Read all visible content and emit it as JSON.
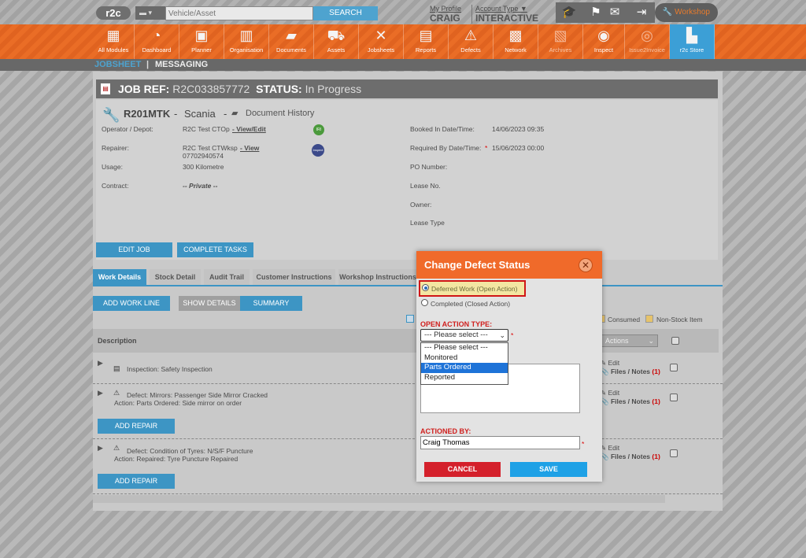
{
  "topbar": {
    "logo": "r2c",
    "search_placeholder": "Vehicle/Asset",
    "search_button": "SEARCH",
    "my_profile_label": "My Profile",
    "user_name": "CRAIG",
    "account_type_label": "Account Type",
    "account_type": "INTERACTIVE",
    "workshop_label": "Workshop"
  },
  "nav": {
    "items": [
      {
        "label": "All Modules",
        "icon": "grid-icon"
      },
      {
        "label": "Dashboard",
        "icon": "gauge-icon"
      },
      {
        "label": "Planner",
        "icon": "calendar-icon"
      },
      {
        "label": "Organisation",
        "icon": "building-icon"
      },
      {
        "label": "Documents",
        "icon": "folder-icon"
      },
      {
        "label": "Assets",
        "icon": "truck-icon"
      },
      {
        "label": "Jobsheets",
        "icon": "tools-icon"
      },
      {
        "label": "Reports",
        "icon": "clipboard-icon"
      },
      {
        "label": "Defects",
        "icon": "warning-icon"
      },
      {
        "label": "Network",
        "icon": "contacts-icon"
      },
      {
        "label": "Archives",
        "icon": "archive-icon"
      },
      {
        "label": "Inspect",
        "icon": "inspect-icon"
      },
      {
        "label": "Issue2Invoice",
        "icon": "invoice-icon"
      },
      {
        "label": "r2c Store",
        "icon": "briefcase-icon"
      }
    ]
  },
  "subnav": {
    "jobsheet": "JOBSHEET",
    "messaging": "MESSAGING"
  },
  "job": {
    "ref_label": "JOB REF:",
    "ref": "R2C033857772",
    "status_label": "STATUS:",
    "status": "In Progress",
    "vehicle": "R201MTK",
    "make": "Scania",
    "doc_history": "Document History",
    "operator_label": "Operator / Depot:",
    "operator": "R2C Test CTOp",
    "operator_link": "- View/Edit",
    "repairer_label": "Repairer:",
    "repairer": "R2C Test CTWksp",
    "repairer_link": "- View",
    "repairer_phone": "07702940574",
    "usage_label": "Usage:",
    "usage": "300 Kilometre",
    "contract_label": "Contract:",
    "contract": "-- Private --",
    "badge1": "IRI",
    "badge2": "Inspect",
    "booked_label": "Booked In Date/Time:",
    "booked": "14/06/2023 09:35",
    "required_label": "Required By Date/Time:",
    "required": "15/06/2023 00:00",
    "po_label": "PO Number:",
    "lease_no_label": "Lease No.",
    "owner_label": "Owner:",
    "lease_type_label": "Lease Type",
    "edit_job": "EDIT JOB",
    "complete_tasks": "COMPLETE TASKS"
  },
  "tabs": [
    "Work Details",
    "Stock Detail",
    "Audit Trail",
    "Customer Instructions",
    "Workshop Instructions"
  ],
  "work": {
    "add_work_line": "ADD WORK LINE",
    "show_details": "SHOW DETAILS",
    "summary": "SUMMARY",
    "consumed": "Consumed",
    "non_stock": "Non-Stock Item",
    "description_header": "Description",
    "actions": "Actions",
    "edit": "Edit",
    "files_notes": "Files / Notes",
    "count": "(1)",
    "add_repair": "ADD REPAIR",
    "lines": [
      {
        "line1": "Inspection: Safety Inspection",
        "line2": ""
      },
      {
        "line1": "Defect: Mirrors: Passenger Side Mirror Cracked",
        "line2": "Action: Parts Ordered: Side mirror on order"
      },
      {
        "line1": "Defect: Condition of Tyres: N/S/F Puncture",
        "line2": "Action: Repaired: Tyre Puncture Repaired"
      }
    ]
  },
  "dialog": {
    "title": "Change Defect Status",
    "option_deferred": "Deferred Work (Open Action)",
    "option_completed": "Completed (Closed Action)",
    "open_action_label": "OPEN ACTION TYPE:",
    "select_value": "--- Please select ---",
    "asterisk": "*",
    "options": [
      "--- Please select ---",
      "Monitored",
      "Parts Ordered",
      "Reported"
    ],
    "actioned_by_label": "ACTIONED BY:",
    "actioned_by": "Craig Thomas",
    "cancel": "CANCEL",
    "save": "SAVE"
  },
  "colors": {
    "accent_orange": "#ea6d26",
    "accent_blue": "#3d95c4",
    "cancel_red": "#d4202b",
    "save_blue": "#1ea1e6"
  }
}
